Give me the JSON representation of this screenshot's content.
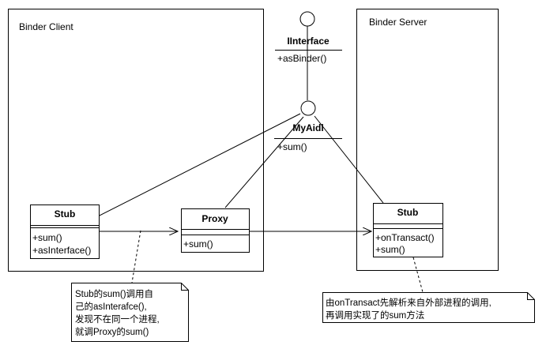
{
  "containers": {
    "client": {
      "label": "Binder Client"
    },
    "server": {
      "label": "Binder Server"
    }
  },
  "interfaces": {
    "iinterface": {
      "name": "IInterface",
      "methods": [
        "+asBinder()"
      ]
    },
    "myaidl": {
      "name": "MyAidl",
      "methods": [
        "+sum()"
      ]
    }
  },
  "classes": {
    "client_stub": {
      "name": "Stub",
      "methods": [
        "+sum()",
        "+asInterface()"
      ]
    },
    "proxy": {
      "name": "Proxy",
      "methods": [
        "+sum()"
      ]
    },
    "server_stub": {
      "name": "Stub",
      "methods": [
        "+onTransact()",
        "+sum()"
      ]
    }
  },
  "notes": {
    "client_note": [
      "Stub的sum()调用自",
      "己的asInterafce(),",
      "发现不在同一个进程,",
      "就调Proxy的sum()"
    ],
    "server_note": [
      "由onTransact先解析来自外部进程的调用,",
      "再调用实现了的sum方法"
    ]
  }
}
